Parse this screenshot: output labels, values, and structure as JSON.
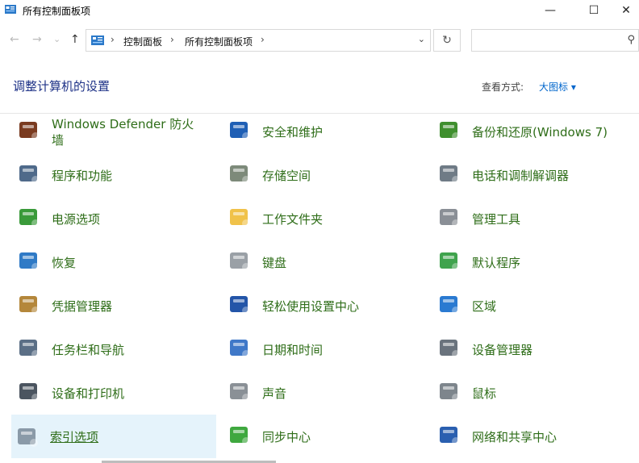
{
  "window": {
    "title": "所有控制面板项",
    "min": "—",
    "max": "☐",
    "close": "✕"
  },
  "address": {
    "crumbs": [
      "控制面板",
      "所有控制面板项"
    ],
    "sep": "›",
    "dropdown": "⌄",
    "refresh": "↻"
  },
  "search": {
    "placeholder": "",
    "glyph": "⚲"
  },
  "nav": {
    "back": "←",
    "forward": "→",
    "recent": "⌄",
    "up": "↑"
  },
  "header": {
    "title": "调整计算机的设置",
    "view_label": "查看方式:",
    "view_value": "大图标 ▾"
  },
  "items": [
    {
      "label": "Windows Defender 防火\n墙",
      "icon": "firewall-icon",
      "color": "#7a3b20"
    },
    {
      "label": "安全和维护",
      "icon": "flag-icon",
      "color": "#1f5fb5"
    },
    {
      "label": "备份和还原(Windows 7)",
      "icon": "backup-icon",
      "color": "#3f8f2e"
    },
    {
      "label": "程序和功能",
      "icon": "programs-icon",
      "color": "#4f6a8a"
    },
    {
      "label": "存储空间",
      "icon": "storage-icon",
      "color": "#7d8a7a"
    },
    {
      "label": "电话和调制解调器",
      "icon": "phone-icon",
      "color": "#6f7b86"
    },
    {
      "label": "电源选项",
      "icon": "power-icon",
      "color": "#3a9a3a"
    },
    {
      "label": "工作文件夹",
      "icon": "folder-icon",
      "color": "#f0c24a"
    },
    {
      "label": "管理工具",
      "icon": "tools-icon",
      "color": "#8a8f96"
    },
    {
      "label": "恢复",
      "icon": "recovery-icon",
      "color": "#2f7ac6"
    },
    {
      "label": "键盘",
      "icon": "keyboard-icon",
      "color": "#9aa0a6"
    },
    {
      "label": "默认程序",
      "icon": "default-programs-icon",
      "color": "#3fa34d"
    },
    {
      "label": "凭据管理器",
      "icon": "credential-icon",
      "color": "#b4873b"
    },
    {
      "label": "轻松使用设置中心",
      "icon": "accessibility-icon",
      "color": "#2355a8"
    },
    {
      "label": "区域",
      "icon": "region-icon",
      "color": "#2a7ad1"
    },
    {
      "label": "任务栏和导航",
      "icon": "taskbar-icon",
      "color": "#5b6f86"
    },
    {
      "label": "日期和时间",
      "icon": "datetime-icon",
      "color": "#3f78c8"
    },
    {
      "label": "设备管理器",
      "icon": "device-manager-icon",
      "color": "#6a737d"
    },
    {
      "label": "设备和打印机",
      "icon": "printer-icon",
      "color": "#4b5560"
    },
    {
      "label": "声音",
      "icon": "speaker-icon",
      "color": "#8a9096"
    },
    {
      "label": "鼠标",
      "icon": "mouse-icon",
      "color": "#7d858c"
    },
    {
      "label": "索引选项",
      "icon": "indexing-icon",
      "color": "#8a9aa8"
    },
    {
      "label": "同步中心",
      "icon": "sync-icon",
      "color": "#3fa83f"
    },
    {
      "label": "网络和共享中心",
      "icon": "network-icon",
      "color": "#2a5fb0"
    }
  ],
  "selected_index": 21
}
